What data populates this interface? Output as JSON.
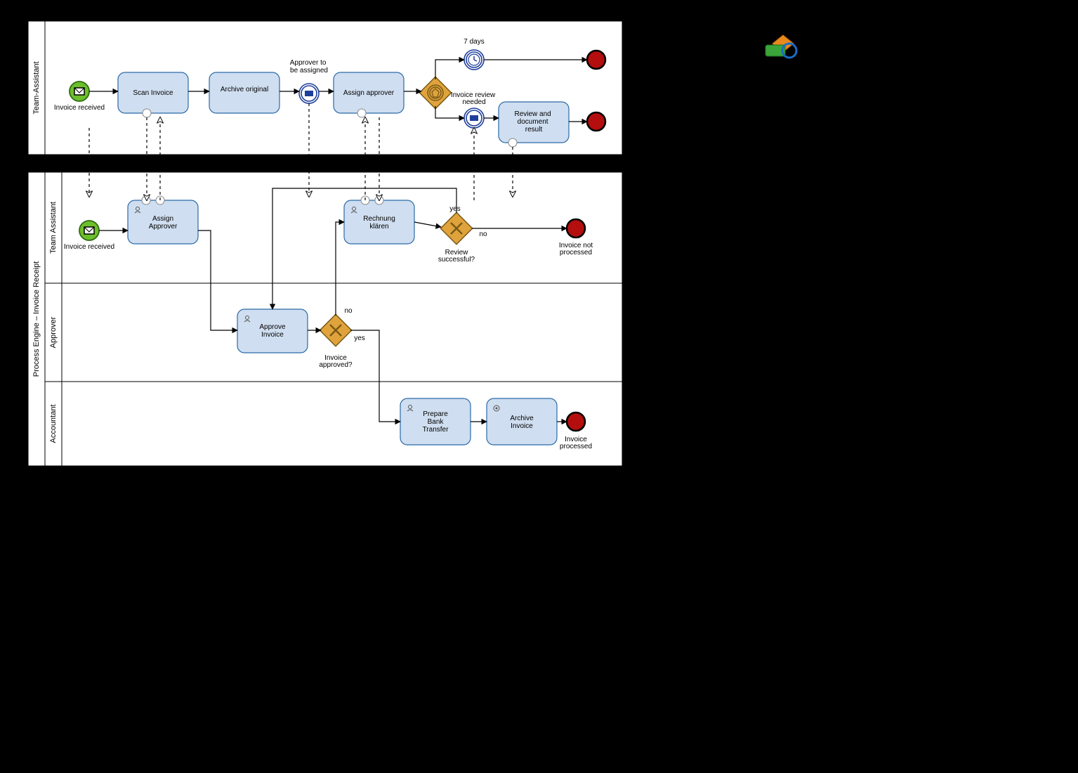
{
  "pool1": {
    "name": "Team-Assistant",
    "start": "Invoice received",
    "task1": "Scan Invoice",
    "task2": "Archive original",
    "throwLabel": "Approver to be assigned",
    "task3": "Assign approver",
    "timerLabel": "7 days",
    "reviewLabel": "Invoice review needed",
    "task4": "Review and document result"
  },
  "pool2": {
    "name": "Process Engine – Invoice Receipt",
    "lane1": {
      "name": "Team Assistant",
      "start": "Invoice received",
      "task1": "Assign Approver",
      "task2": "Rechnung klären",
      "gwLabel": "Review successful?",
      "yes": "yes",
      "no": "no",
      "end": "Invoice not processed"
    },
    "lane2": {
      "name": "Approver",
      "task": "Approve Invoice",
      "gwLabel": "Invoice approved?",
      "yes": "yes",
      "no": "no"
    },
    "lane3": {
      "name": "Accountant",
      "task1": "Prepare Bank Transfer",
      "task2": "Archive Invoice",
      "end": "Invoice processed"
    }
  }
}
